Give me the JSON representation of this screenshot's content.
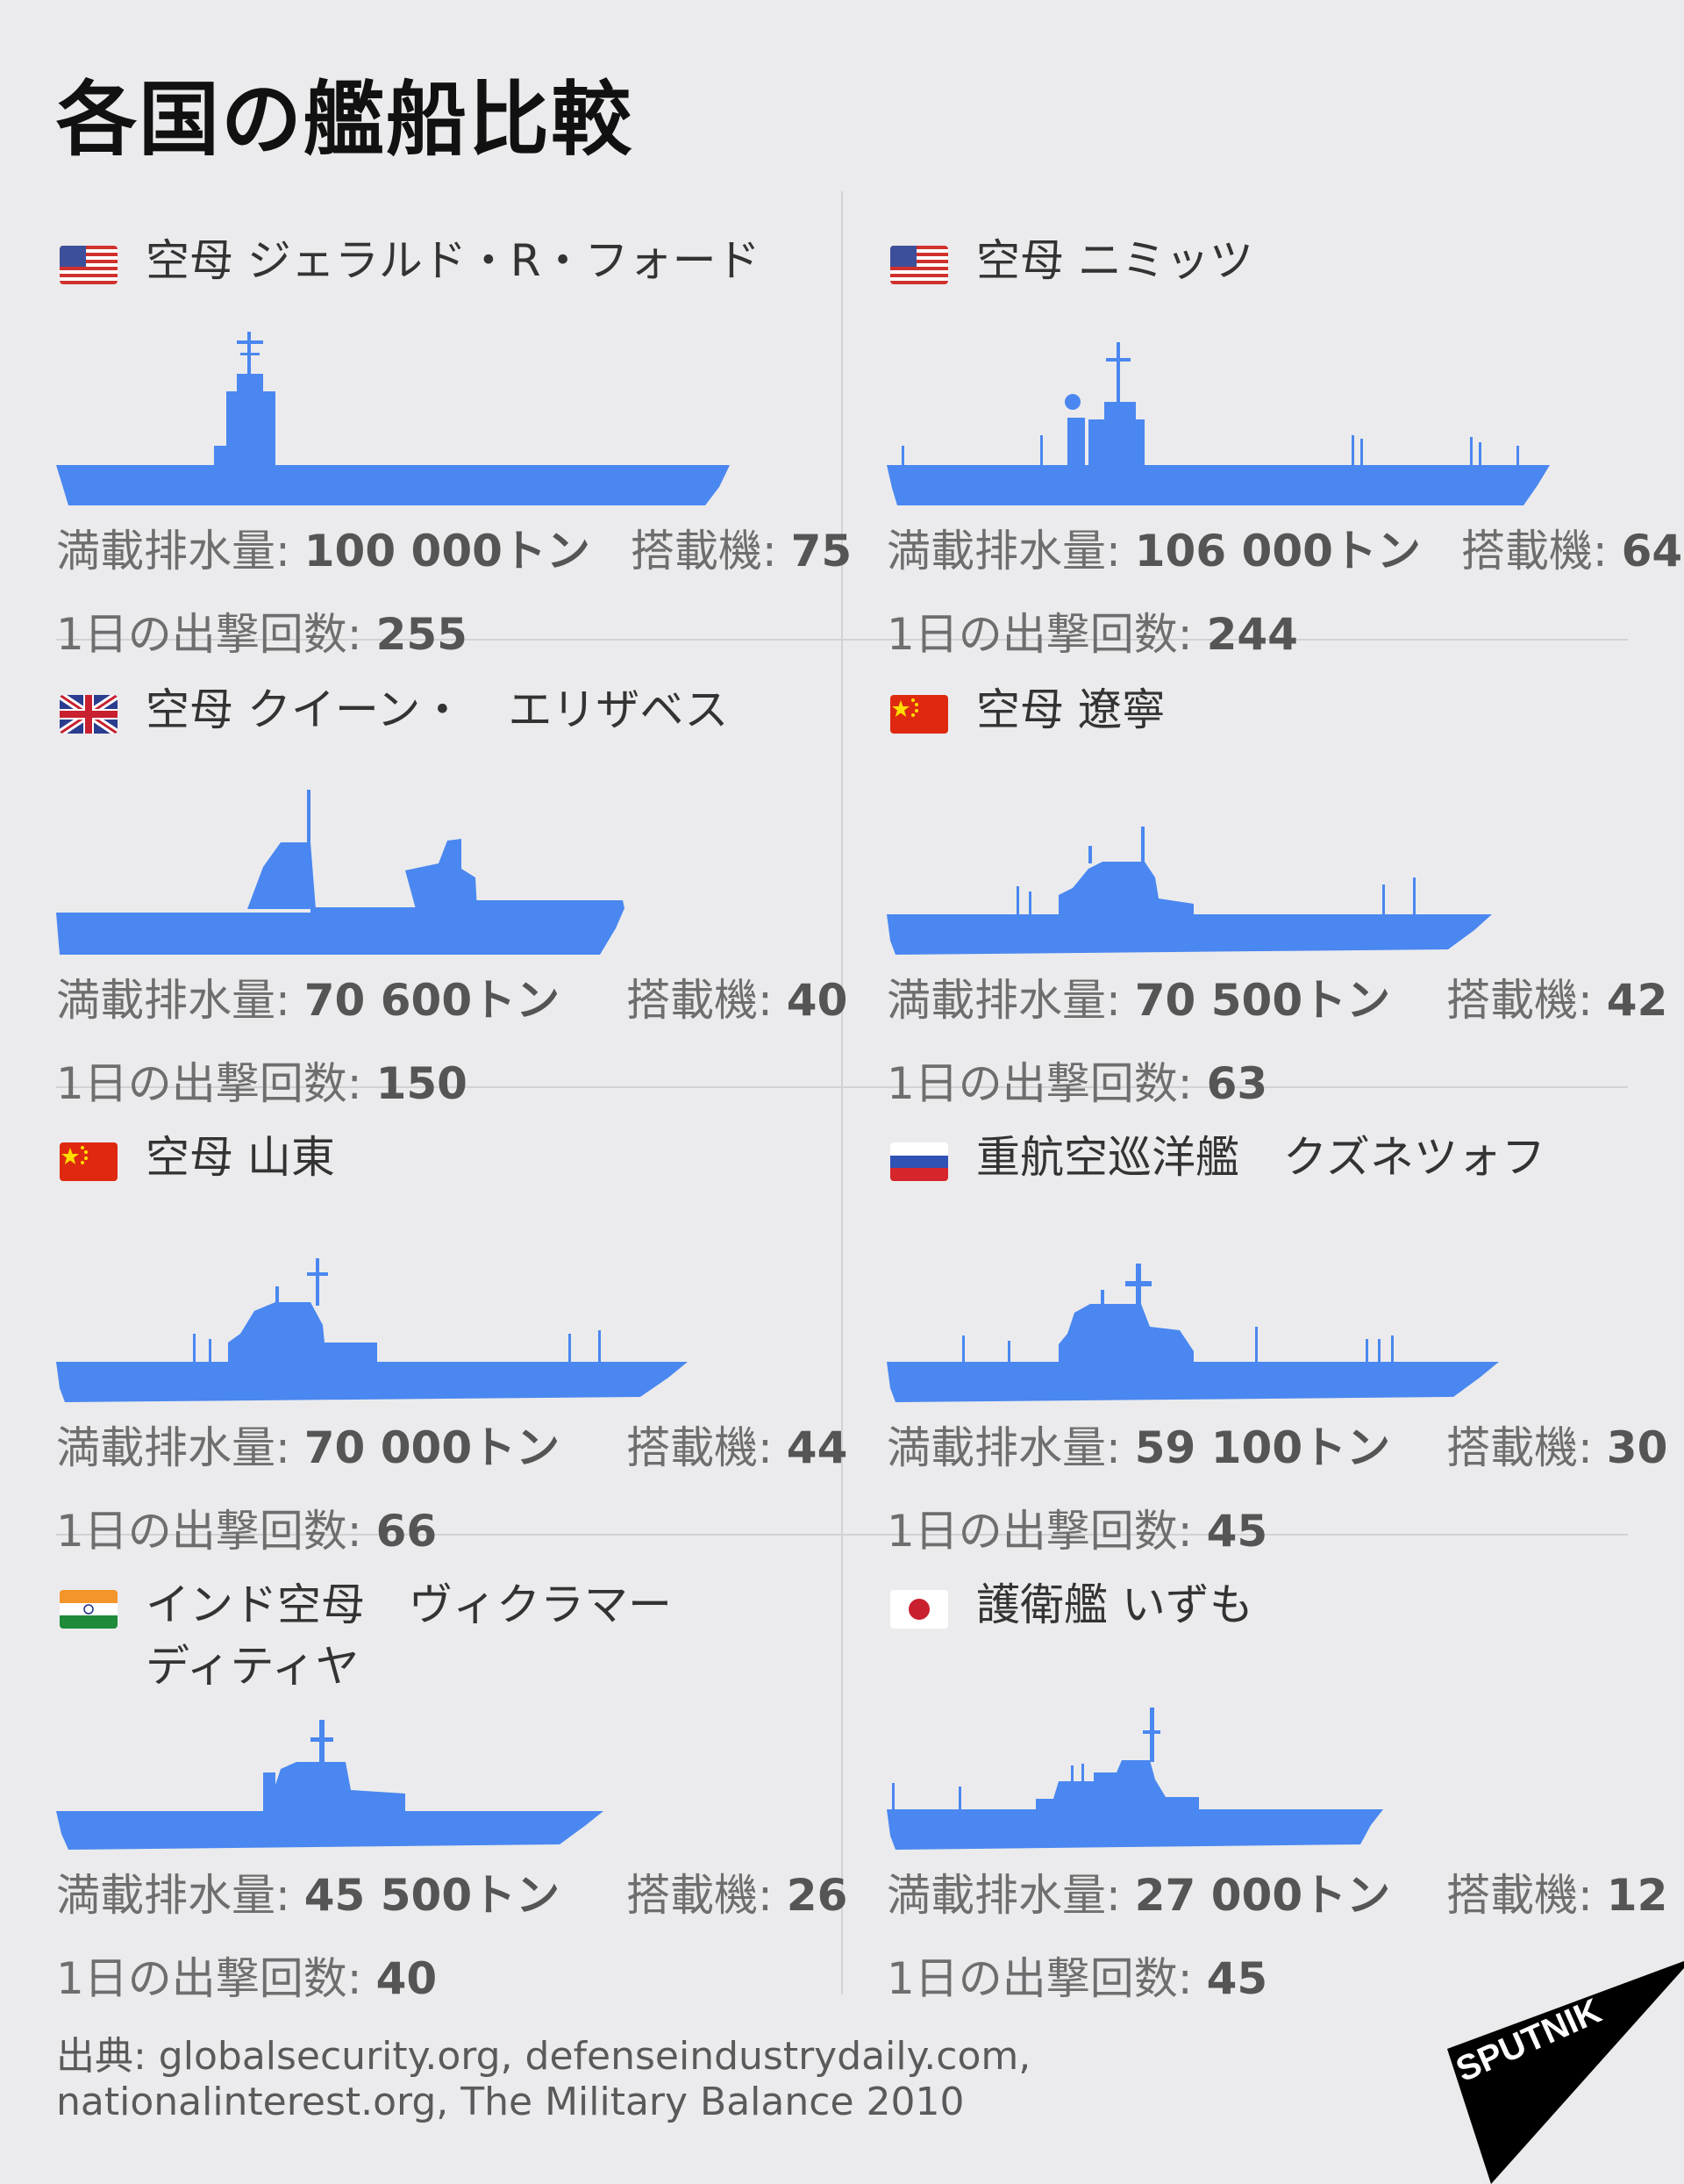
{
  "title": "各国の艦船比較",
  "labels": {
    "displacement": "満載排水量:",
    "aircraft": "搭載機:",
    "sorties": "1日の出撃回数:"
  },
  "ships": [
    {
      "name": "空母 ジェラルド・R・フォード",
      "flag": "us-flag-icon",
      "displacement": "100 000トン",
      "aircraft": "75",
      "sorties": "255"
    },
    {
      "name": "空母 ニミッツ",
      "flag": "us-flag-icon",
      "displacement": "106 000トン",
      "aircraft": "64",
      "sorties": "244"
    },
    {
      "name": "空母 クイーン・　エリザベス",
      "flag": "uk-flag-icon",
      "displacement": "70 600トン",
      "aircraft": "40",
      "sorties": "150"
    },
    {
      "name": "空母 遼寧",
      "flag": "china-flag-icon",
      "displacement": "70 500トン",
      "aircraft": "42",
      "sorties": "63"
    },
    {
      "name": "空母 山東",
      "flag": "china-flag-icon",
      "displacement": "70 000トン",
      "aircraft": "44",
      "sorties": "66"
    },
    {
      "name": "重航空巡洋艦　クズネツォフ",
      "flag": "russia-flag-icon",
      "displacement": "59 100トン",
      "aircraft": "30",
      "sorties": "45"
    },
    {
      "name": "インド空母　ヴィクラマー\nディティヤ",
      "flag": "india-flag-icon",
      "displacement": "45 500トン",
      "aircraft": "26",
      "sorties": "40"
    },
    {
      "name": "護衛艦 いずも",
      "flag": "japan-flag-icon",
      "displacement": "27 000トン",
      "aircraft": "12",
      "sorties": "45"
    }
  ],
  "source": "出典: globalsecurity.org, defenseindustrydaily.com, nationalinterest.org, The Military Balance 2010",
  "logo": "SPUTNIK",
  "colors": {
    "ship": "#4a87f0",
    "background": "#ebebed"
  }
}
